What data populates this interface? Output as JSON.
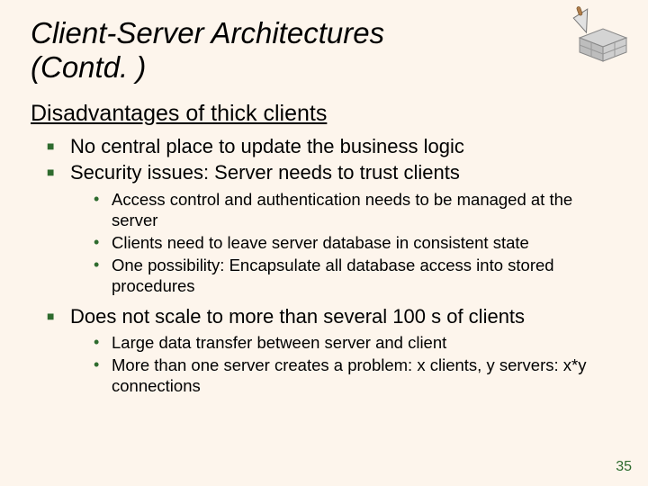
{
  "title_line1": "Client-Server Architectures",
  "title_line2": "(Contd. )",
  "section_heading": "Disadvantages of thick clients",
  "bullets": {
    "b1": "No central place to update the business logic",
    "b2": "Security issues: Server needs to trust clients",
    "b2_sub": {
      "s1": "Access control and authentication needs to be managed at the server",
      "s2": "Clients need to leave server database in consistent state",
      "s3": "One possibility: Encapsulate all database access into stored procedures"
    },
    "b3": "Does not scale to more than several 100 s of clients",
    "b3_sub": {
      "s1": "Large data transfer between server and client",
      "s2": "More than one server creates a problem: x clients, y servers: x*y connections"
    }
  },
  "page_number": "35"
}
